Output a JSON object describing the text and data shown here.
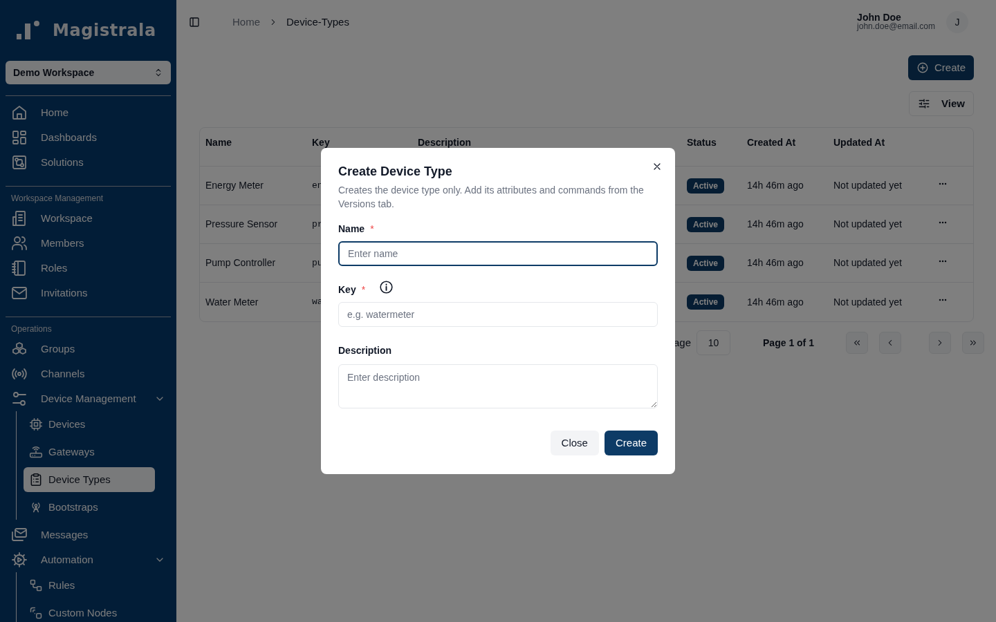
{
  "sidebar": {
    "brand": "Magistrala",
    "workspace_selector": "Demo Workspace",
    "sections": [
      {
        "items": [
          {
            "label": "Home",
            "selected": false
          },
          {
            "label": "Dashboards",
            "selected": false
          },
          {
            "label": "Solutions",
            "selected": false
          }
        ]
      },
      {
        "title": "Workspace Management",
        "items": [
          {
            "label": "Workspace",
            "selected": false
          },
          {
            "label": "Members",
            "selected": false
          },
          {
            "label": "Roles",
            "selected": false
          },
          {
            "label": "Invitations",
            "selected": false
          }
        ]
      },
      {
        "title": "Operations",
        "items": [
          {
            "label": "Groups",
            "selected": false
          },
          {
            "label": "Channels",
            "selected": false
          },
          {
            "label": "Device Management",
            "selected": false,
            "expanded": true,
            "children": [
              {
                "label": "Devices",
                "selected": false
              },
              {
                "label": "Gateways",
                "selected": false
              },
              {
                "label": "Device Types",
                "selected": true
              },
              {
                "label": "Bootstraps",
                "selected": false
              }
            ]
          },
          {
            "label": "Messages",
            "selected": false
          },
          {
            "label": "Automation",
            "selected": false,
            "expanded": true,
            "children": [
              {
                "label": "Rules",
                "selected": false
              },
              {
                "label": "Custom Nodes",
                "selected": false
              }
            ]
          }
        ]
      }
    ]
  },
  "header": {
    "breadcrumbs": [
      "Home",
      "Device-Types"
    ],
    "user": {
      "name": "John Doe",
      "email": "john.doe@email.com",
      "initial": "J"
    }
  },
  "toolbar": {
    "create_button": "Create",
    "view_button": "View"
  },
  "table": {
    "columns": [
      "Name",
      "Key",
      "Description",
      "Status",
      "Created At",
      "Updated At"
    ],
    "rows": [
      {
        "name": "Energy Meter",
        "key": "en",
        "status": "Active",
        "created_at": "14h 46m ago",
        "updated_at": "Not updated yet"
      },
      {
        "name": "Pressure Sensor",
        "key": "pr",
        "status": "Active",
        "created_at": "14h 46m ago",
        "updated_at": "Not updated yet"
      },
      {
        "name": "Pump Controller",
        "key": "pu",
        "status": "Active",
        "created_at": "14h 46m ago",
        "updated_at": "Not updated yet"
      },
      {
        "name": "Water Meter",
        "key": "wa",
        "status": "Active",
        "created_at": "14h 46m ago",
        "updated_at": "Not updated yet"
      }
    ]
  },
  "pagination": {
    "rows_per_page_label": "age",
    "rows_per_page": "10",
    "page_info": "Page 1 of 1"
  },
  "dialog": {
    "title": "Create Device Type",
    "description": "Creates the device type only. Add its attributes and commands from the Versions tab.",
    "fields": [
      {
        "kind": "input",
        "label": "Name",
        "required_mark": "*",
        "info": false,
        "placeholder": "Enter name",
        "focused": true
      },
      {
        "kind": "input",
        "label": "Key",
        "required_mark": "*",
        "info": true,
        "placeholder": "e.g. watermeter",
        "focused": false
      },
      {
        "kind": "textarea",
        "label": "Description",
        "info": false,
        "placeholder": "Enter description",
        "focused": false
      }
    ],
    "buttons": [
      {
        "label": "Close",
        "kind": "secondary"
      },
      {
        "label": "Create",
        "kind": "primary"
      }
    ]
  }
}
